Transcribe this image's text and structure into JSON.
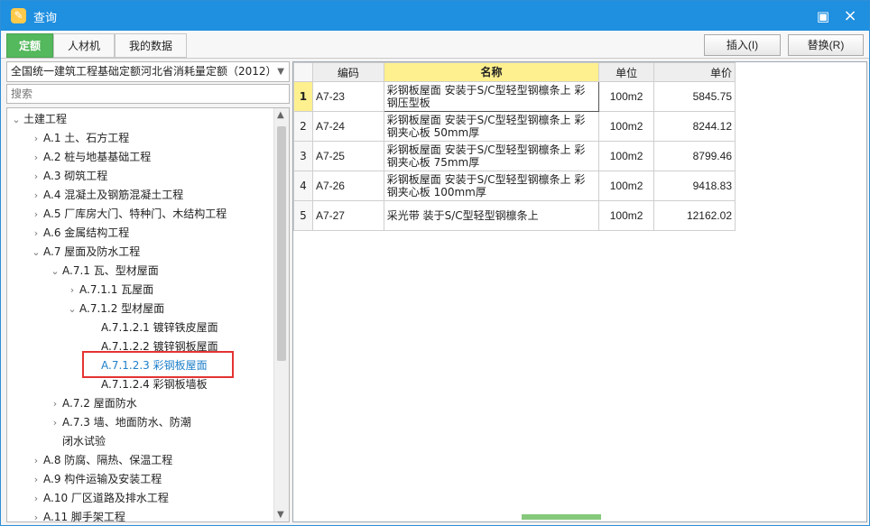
{
  "window": {
    "title": "查询",
    "maximize_symbol": "▣",
    "close_symbol": "×"
  },
  "tabs": [
    {
      "label": "定额"
    },
    {
      "label": "人材机"
    },
    {
      "label": "我的数据"
    }
  ],
  "actions": {
    "insert_label": "插入(I)",
    "replace_label": "替换(R)"
  },
  "left_panel": {
    "quota_select": "全国统一建筑工程基础定额河北省消耗量定额（2012）",
    "search_placeholder": "搜索"
  },
  "tree": [
    {
      "label": "土建工程",
      "chevron": "⌄"
    },
    {
      "label": "A.1 土、石方工程",
      "chevron": "›"
    },
    {
      "label": "A.2 桩与地基基础工程",
      "chevron": "›"
    },
    {
      "label": "A.3 砌筑工程",
      "chevron": "›"
    },
    {
      "label": "A.4 混凝土及钢筋混凝土工程",
      "chevron": "›"
    },
    {
      "label": "A.5 厂库房大门、特种门、木结构工程",
      "chevron": "›"
    },
    {
      "label": "A.6 金属结构工程",
      "chevron": "›"
    },
    {
      "label": "A.7 屋面及防水工程",
      "chevron": "⌄"
    },
    {
      "label": "A.7.1 瓦、型材屋面",
      "chevron": "⌄"
    },
    {
      "label": "A.7.1.1 瓦屋面",
      "chevron": "›"
    },
    {
      "label": "A.7.1.2 型材屋面",
      "chevron": "⌄"
    },
    {
      "label": "A.7.1.2.1 镀锌铁皮屋面",
      "chevron": ""
    },
    {
      "label": "A.7.1.2.2 镀锌钢板屋面",
      "chevron": ""
    },
    {
      "label": "A.7.1.2.3 彩钢板屋面",
      "chevron": ""
    },
    {
      "label": "A.7.1.2.4 彩钢板墙板",
      "chevron": ""
    },
    {
      "label": "A.7.2 屋面防水",
      "chevron": "›"
    },
    {
      "label": "A.7.3 墙、地面防水、防潮",
      "chevron": "›"
    },
    {
      "label": "闭水试验",
      "chevron": ""
    },
    {
      "label": "A.8 防腐、隔热、保温工程",
      "chevron": "›"
    },
    {
      "label": "A.9 构件运输及安装工程",
      "chevron": "›"
    },
    {
      "label": "A.10 厂区道路及排水工程",
      "chevron": "›"
    },
    {
      "label": "A.11 脚手架工程",
      "chevron": "›"
    }
  ],
  "table": {
    "headers": [
      "编码",
      "名称",
      "单位",
      "单价"
    ],
    "rows": [
      {
        "index": "1",
        "code": "A7-23",
        "name": "彩钢板屋面 安装于S/C型轻型钢檩条上 彩钢压型板",
        "unit": "100m2",
        "price": "5845.75"
      },
      {
        "index": "2",
        "code": "A7-24",
        "name": "彩钢板屋面 安装于S/C型轻型钢檩条上 彩钢夹心板 50mm厚",
        "unit": "100m2",
        "price": "8244.12"
      },
      {
        "index": "3",
        "code": "A7-25",
        "name": "彩钢板屋面 安装于S/C型轻型钢檩条上 彩钢夹心板 75mm厚",
        "unit": "100m2",
        "price": "8799.46"
      },
      {
        "index": "4",
        "code": "A7-26",
        "name": "彩钢板屋面 安装于S/C型轻型钢檩条上 彩钢夹心板 100mm厚",
        "unit": "100m2",
        "price": "9418.83"
      },
      {
        "index": "5",
        "code": "A7-27",
        "name": "采光带 装于S/C型轻型钢檩条上",
        "unit": "100m2",
        "price": "12162.02"
      }
    ]
  },
  "colors": {
    "titlebar": "#1f8fe0",
    "active_tab": "#54b85c",
    "highlight_box": "#e53333",
    "selected_header": "#fff08f"
  }
}
